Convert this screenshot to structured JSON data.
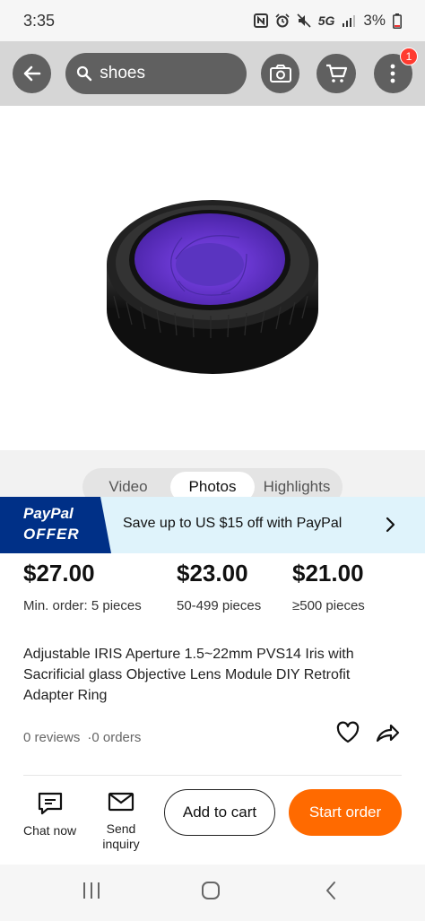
{
  "status": {
    "time": "3:35",
    "network": "5G",
    "battery": "3%"
  },
  "search": {
    "query": "shoes"
  },
  "cart": {
    "badge_count": "1"
  },
  "media_tabs": [
    {
      "label": "Video"
    },
    {
      "label": "Photos"
    },
    {
      "label": "Highlights"
    }
  ],
  "media_tabs_active": "Photos",
  "paypal": {
    "logo_line1": "PayPal",
    "logo_line2": "OFFER",
    "message": "Save up to US $15 off with PayPal"
  },
  "prices": [
    {
      "price": "$27.00",
      "range": "Min. order: 5 pieces"
    },
    {
      "price": "$23.00",
      "range": "50-499 pieces"
    },
    {
      "price": "$21.00",
      "range": "≥500 pieces"
    }
  ],
  "product": {
    "title": "Adjustable IRIS Aperture 1.5~22mm PVS14 Iris with Sacrificial glass Objective Lens Module DIY Retrofit Adapter Ring",
    "reviews": "0 reviews",
    "orders": "·0 orders"
  },
  "actions": {
    "chat_label": "Chat now",
    "inquiry_label": "Send inquiry",
    "add_to_cart": "Add to cart",
    "start_order": "Start order"
  },
  "colors": {
    "accent": "#ff6a00",
    "paypal_blue": "#003087",
    "banner_bg": "#dff3fb"
  }
}
